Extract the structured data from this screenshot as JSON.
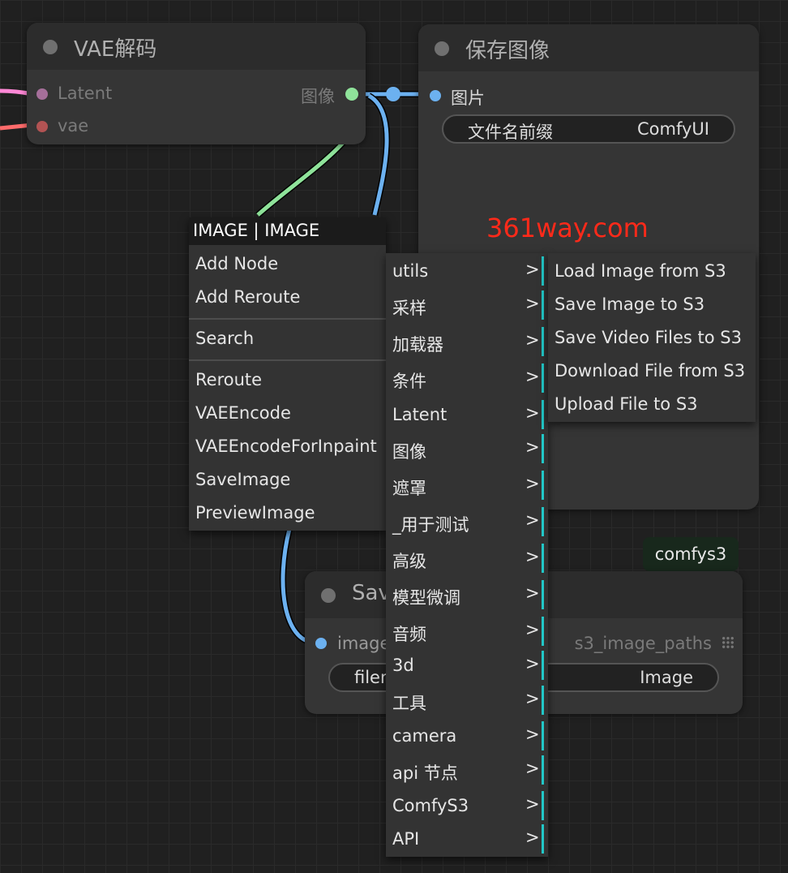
{
  "watermark": "361way.com",
  "vae_node": {
    "title": "VAE解码",
    "inputs": [
      "Latent",
      "vae"
    ],
    "output": "图像"
  },
  "save_node": {
    "title": "保存图像",
    "input": "图片",
    "widget_label": "文件名前缀",
    "widget_value": "ComfyUI"
  },
  "s3_node": {
    "title_visible": "Sav",
    "badge": "comfys3",
    "input": "image",
    "output": "s3_image_paths",
    "widget_label": "filen",
    "widget_value": "Image"
  },
  "context_menu": {
    "header": "IMAGE | IMAGE",
    "items_top": [
      "Add Node",
      "Add Reroute"
    ],
    "search": "Search",
    "items_bottom": [
      "Reroute",
      "VAEEncode",
      "VAEEncodeForInpaint",
      "SaveImage",
      "PreviewImage"
    ]
  },
  "category_menu": {
    "arrow": ">",
    "items": [
      "utils",
      "采样",
      "加载器",
      "条件",
      "Latent",
      "图像",
      "遮罩",
      "_用于测试",
      "高级",
      "模型微调",
      "音频",
      "3d",
      "工具",
      "camera",
      "api 节点",
      "ComfyS3",
      "API"
    ]
  },
  "utils_submenu": {
    "items": [
      "Load Image from S3",
      "Save Image to S3",
      "Save Video Files to S3",
      "Download File from S3",
      "Upload File to S3"
    ]
  },
  "colors": {
    "latent_wire": "#ff88d6",
    "vae_wire": "#ff6b6b",
    "image_wire_green": "#8fe39a",
    "image_wire_blue": "#6cb1f0",
    "menu_accent": "#22c7c7"
  }
}
